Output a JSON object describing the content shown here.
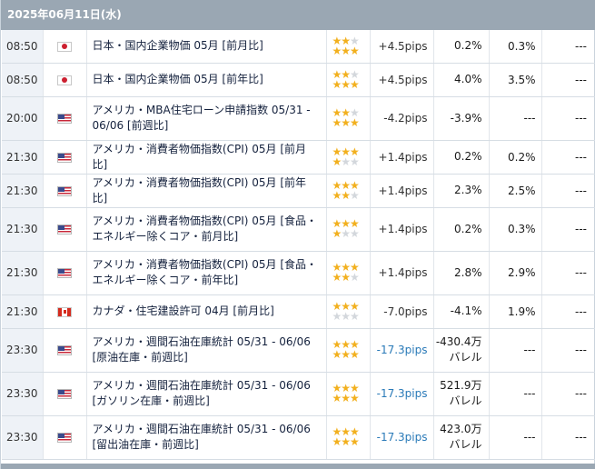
{
  "date_header": "2025年06月11日(水)",
  "rows": [
    {
      "time": "08:50",
      "country": "jp",
      "name": "日本・国内企業物価 05月 [前月比]",
      "stars": [
        2,
        3
      ],
      "pips": "+4.5pips",
      "pips_color": "dark",
      "actual": "0.2%",
      "forecast": "0.3%",
      "previous": "---"
    },
    {
      "time": "08:50",
      "country": "jp",
      "name": "日本・国内企業物価 05月 [前年比]",
      "stars": [
        2,
        3
      ],
      "pips": "+4.5pips",
      "pips_color": "dark",
      "actual": "4.0%",
      "forecast": "3.5%",
      "previous": "---"
    },
    {
      "time": "20:00",
      "country": "us",
      "name": "アメリカ・MBA住宅ローン申請指数 05/31 - 06/06 [前週比]",
      "stars": [
        2,
        3
      ],
      "pips": "-4.2pips",
      "pips_color": "dark",
      "actual": "-3.9%",
      "forecast": "---",
      "previous": "---"
    },
    {
      "time": "21:30",
      "country": "us",
      "name": "アメリカ・消費者物価指数(CPI) 05月 [前月比]",
      "stars": [
        3,
        1
      ],
      "pips": "+1.4pips",
      "pips_color": "dark",
      "actual": "0.2%",
      "forecast": "0.2%",
      "previous": "---"
    },
    {
      "time": "21:30",
      "country": "us",
      "name": "アメリカ・消費者物価指数(CPI) 05月 [前年比]",
      "stars": [
        3,
        2
      ],
      "pips": "+1.4pips",
      "pips_color": "dark",
      "actual": "2.3%",
      "forecast": "2.5%",
      "previous": "---"
    },
    {
      "time": "21:30",
      "country": "us",
      "name": "アメリカ・消費者物価指数(CPI) 05月 [食品・エネルギー除くコア・前月比]",
      "stars": [
        3,
        1
      ],
      "pips": "+1.4pips",
      "pips_color": "dark",
      "actual": "0.2%",
      "forecast": "0.3%",
      "previous": "---"
    },
    {
      "time": "21:30",
      "country": "us",
      "name": "アメリカ・消費者物価指数(CPI) 05月 [食品・エネルギー除くコア・前年比]",
      "stars": [
        3,
        2
      ],
      "pips": "+1.4pips",
      "pips_color": "dark",
      "actual": "2.8%",
      "forecast": "2.9%",
      "previous": "---"
    },
    {
      "time": "21:30",
      "country": "ca",
      "name": "カナダ・住宅建設許可 04月 [前月比]",
      "stars": [
        3,
        0
      ],
      "pips": "-7.0pips",
      "pips_color": "dark",
      "actual": "-4.1%",
      "forecast": "1.9%",
      "previous": "---"
    },
    {
      "time": "23:30",
      "country": "us",
      "name": "アメリカ・週間石油在庫統計 05/31 - 06/06 [原油在庫・前週比]",
      "stars": [
        3,
        3
      ],
      "pips": "-17.3pips",
      "pips_color": "blue",
      "actual": "-430.4万バレル",
      "forecast": "---",
      "previous": "---"
    },
    {
      "time": "23:30",
      "country": "us",
      "name": "アメリカ・週間石油在庫統計 05/31 - 06/06 [ガソリン在庫・前週比]",
      "stars": [
        3,
        3
      ],
      "pips": "-17.3pips",
      "pips_color": "blue",
      "actual": "521.9万バレル",
      "forecast": "---",
      "previous": "---"
    },
    {
      "time": "23:30",
      "country": "us",
      "name": "アメリカ・週間石油在庫統計 05/31 - 06/06 [留出油在庫・前週比]",
      "stars": [
        3,
        3
      ],
      "pips": "-17.3pips",
      "pips_color": "blue",
      "actual": "423.0万バレル",
      "forecast": "---",
      "previous": "---"
    }
  ],
  "colors": {
    "header_bg": "#9aa7b3",
    "time_bg": "#eef2f7",
    "star_on": "#f2b01e",
    "star_off": "#d3d7dc",
    "pips_blue": "#2a7ab8"
  }
}
